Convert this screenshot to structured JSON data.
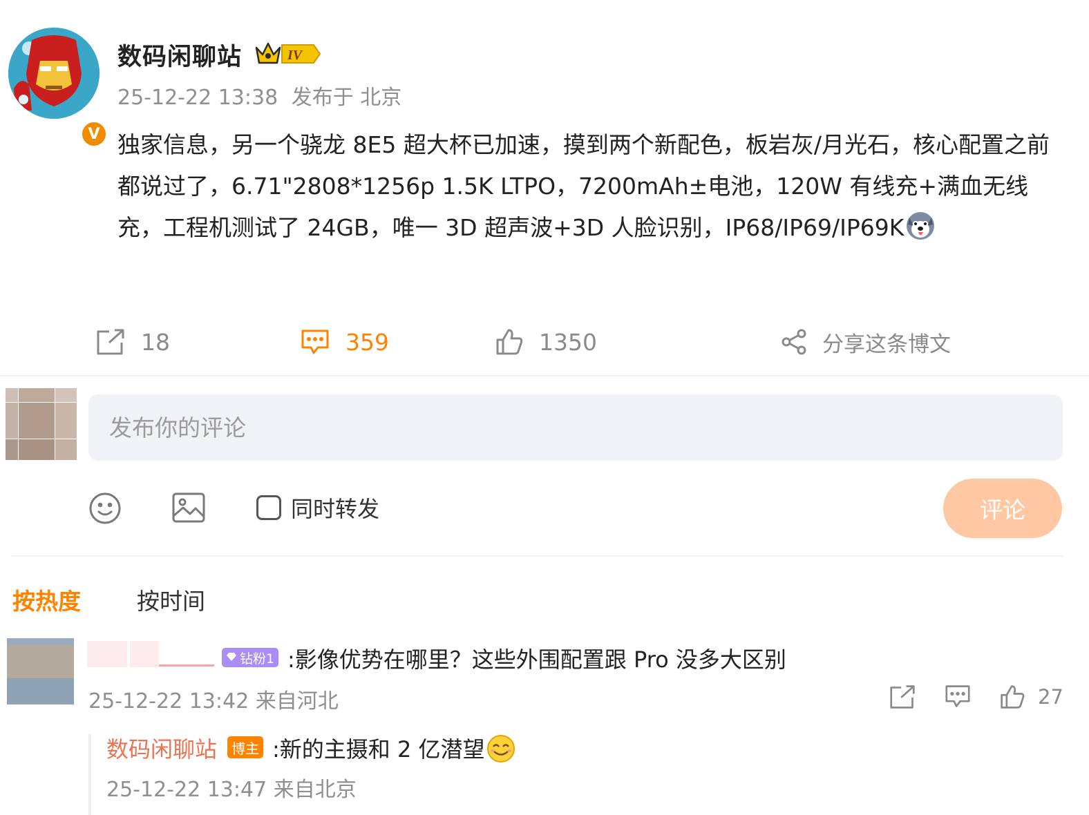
{
  "post": {
    "author": "数码闲聊站",
    "level_badge": "IV",
    "verified_badge": "V",
    "timestamp": "25-12-22 13:38",
    "location": "发布于 北京",
    "text": "独家信息，另一个骁龙 8E5 超大杯已加速，摸到两个新配色，板岩灰/月光石，核心配置之前都说过了，6.71\"2808*1256p 1.5K LTPO，7200mAh±电池，120W 有线充+满血无线充，工程机测试了 24GB，唯一 3D 超声波+3D 人脸识别，IP68/IP69/IP69K",
    "emoji": "husky-emoji",
    "actions": {
      "repost_count": "18",
      "comment_count": "359",
      "like_count": "1350",
      "share_label": "分享这条博文"
    }
  },
  "composer": {
    "placeholder": "发布你的评论",
    "repost_label": "同时转发",
    "submit_label": "评论"
  },
  "sort_tabs": {
    "hot": "按热度",
    "time": "按时间"
  },
  "comments": [
    {
      "fan_badge": "钻粉1",
      "text": ":影像优势在哪里？这些外围配置跟 Pro 没多大区别",
      "timestamp": "25-12-22 13:42 来自河北",
      "like_count": "27",
      "reply": {
        "author": "数码闲聊站",
        "badge": "博主",
        "text": ":新的主摄和 2 亿潜望",
        "emoji": "smile-emoji",
        "timestamp": "25-12-22 13:47 来自北京"
      }
    }
  ],
  "colors": {
    "accent": "#ff8200",
    "submit_disabled": "#ffc8a2",
    "reply_name": "#eb7350",
    "fan_badge": "#a98cf5",
    "meta_text": "#8f8f8f"
  }
}
